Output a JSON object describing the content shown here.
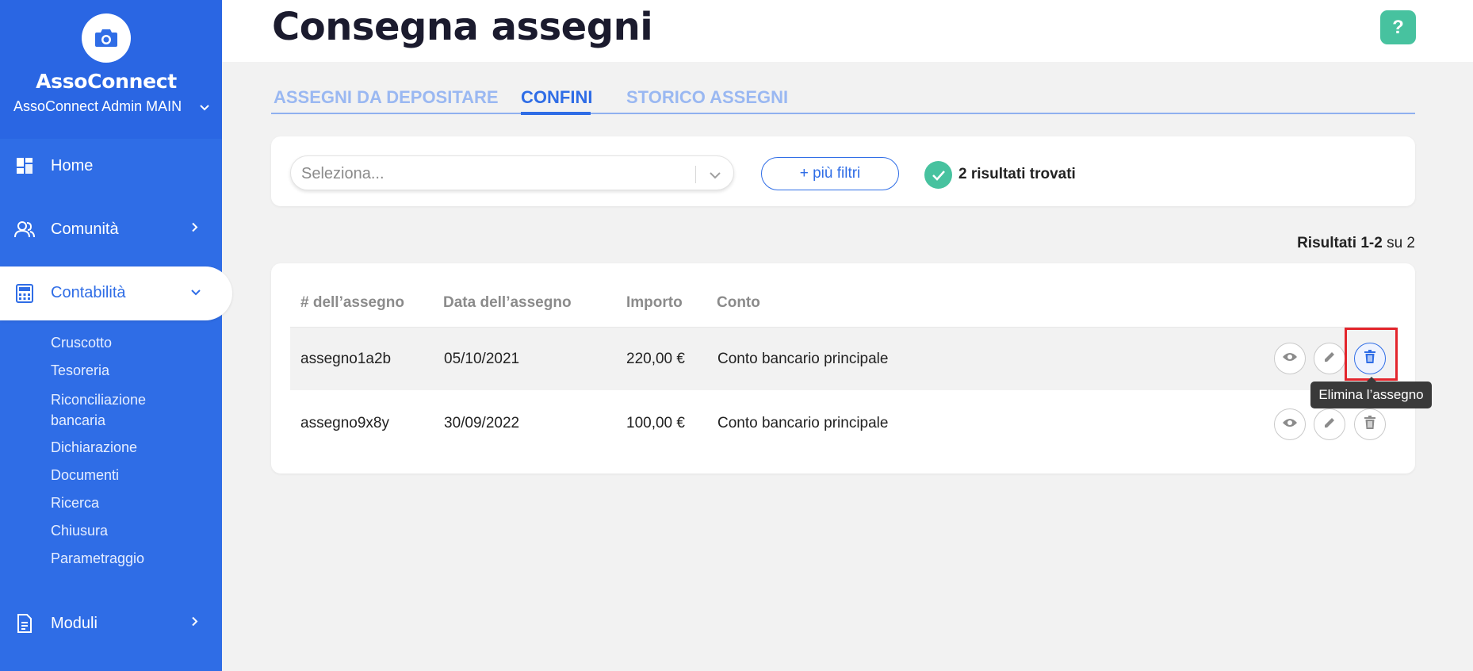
{
  "brand": {
    "name": "AssoConnect",
    "org": "AssoConnect Admin MAIN"
  },
  "nav": {
    "home": "Home",
    "community": "Comunità",
    "accounting": "Contabilità",
    "modules": "Moduli",
    "accounting_items": [
      "Cruscotto",
      "Tesoreria",
      "Riconciliazione bancaria",
      "Dichiarazione",
      "Documenti",
      "Ricerca",
      "Chiusura",
      "Parametraggio"
    ]
  },
  "header": {
    "title": "Consegna assegni",
    "help_label": "?"
  },
  "tabs": [
    {
      "label": "ASSEGNI DA DEPOSITARE"
    },
    {
      "label": "CONFINI"
    },
    {
      "label": "STORICO ASSEGNI"
    }
  ],
  "filters": {
    "select_placeholder": "Seleziona...",
    "more_filters": "+ più filtri",
    "results_found": "2 risultati trovati"
  },
  "results": {
    "prefix": "Risultati",
    "range": "1-2",
    "middle": "su",
    "total": "2"
  },
  "table": {
    "columns": [
      "# dell’assegno",
      "Data dell’assegno",
      "Importo",
      "Conto"
    ],
    "rows": [
      {
        "number": "assegno1a2b",
        "date": "05/10/2021",
        "amount": "220,00 €",
        "account": "Conto bancario principale"
      },
      {
        "number": "assegno9x8y",
        "date": "30/09/2022",
        "amount": "100,00 €",
        "account": "Conto bancario principale"
      }
    ]
  },
  "tooltip": "Elimina l’assegno",
  "colors": {
    "primary": "#2f6de6",
    "success": "#47c29f",
    "highlight": "#e3252c"
  }
}
